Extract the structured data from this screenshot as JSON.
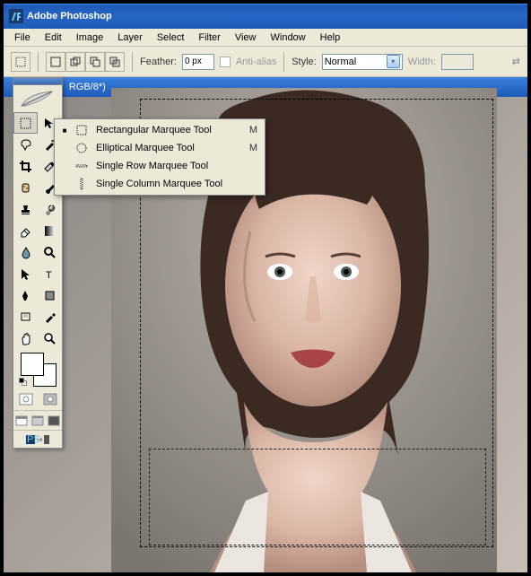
{
  "app": {
    "title": "Adobe Photoshop"
  },
  "menu": {
    "items": [
      "File",
      "Edit",
      "Image",
      "Layer",
      "Select",
      "Filter",
      "View",
      "Window",
      "Help"
    ]
  },
  "options": {
    "feather_label": "Feather:",
    "feather_value": "0 px",
    "antialias_label": "Anti-alias",
    "style_label": "Style:",
    "style_value": "Normal",
    "width_label": "Width:",
    "width_value": ""
  },
  "document": {
    "title_partial": "RGB/8*)"
  },
  "tools": {
    "col1": [
      "marquee",
      "lasso",
      "crop",
      "healing",
      "stamp",
      "eraser",
      "blur",
      "path-select",
      "pen",
      "notes",
      "eyedropper",
      "hand"
    ],
    "col2": [
      "move",
      "wand",
      "slice",
      "brush",
      "history-brush",
      "bucket",
      "dodge",
      "type",
      "shape",
      "measure",
      "color-sampler",
      "zoom"
    ]
  },
  "flyout": {
    "items": [
      {
        "name": "Rectangular Marquee Tool",
        "key": "M",
        "selected": true,
        "icon": "rect"
      },
      {
        "name": "Elliptical Marquee Tool",
        "key": "M",
        "selected": false,
        "icon": "ellipse"
      },
      {
        "name": "Single Row Marquee Tool",
        "key": "",
        "selected": false,
        "icon": "row"
      },
      {
        "name": "Single Column Marquee Tool",
        "key": "",
        "selected": false,
        "icon": "col"
      }
    ]
  }
}
